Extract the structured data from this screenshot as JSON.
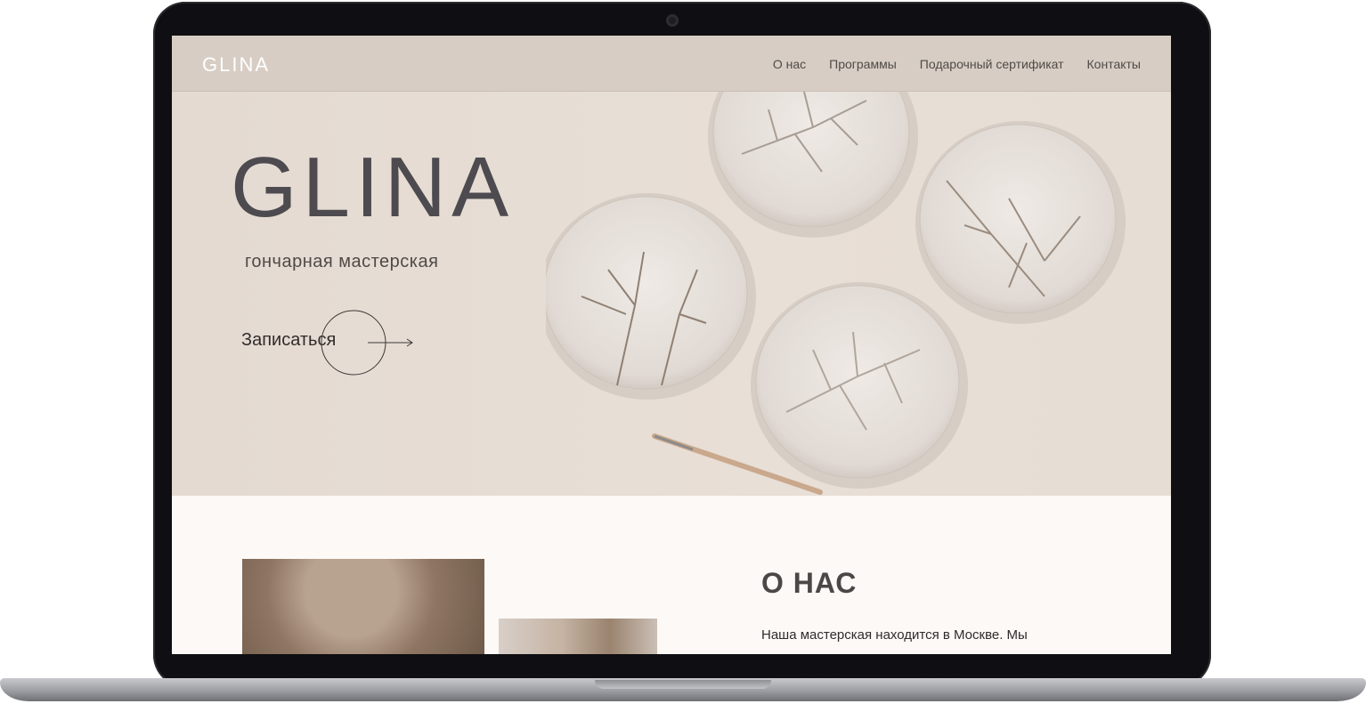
{
  "nav": {
    "logo": "GLINA",
    "links": [
      "О нас",
      "Программы",
      "Подарочный сертификат",
      "Контакты"
    ]
  },
  "hero": {
    "title": "GLINA",
    "subtitle": "гончарная мастерская",
    "cta_label": "Записаться"
  },
  "about": {
    "heading": "О НАС",
    "text": "Наша мастерская находится в Москве. Мы"
  }
}
